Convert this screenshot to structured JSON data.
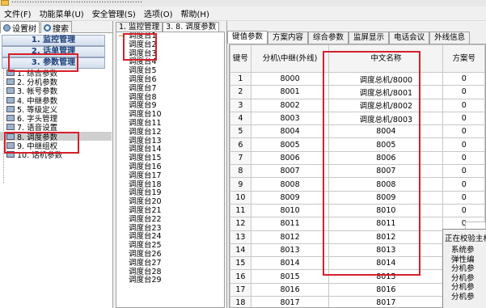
{
  "title_bar": {
    "text": "..................................................."
  },
  "menu": [
    "文件(F)",
    "功能菜单(U)",
    "安全管理(S)",
    "选项(O)",
    "帮助(H)"
  ],
  "left_panel": {
    "tabs": [
      "设置树",
      "搜索"
    ],
    "nav_buttons": [
      "1. 监控管理",
      "2. 话单管理",
      "3. 参数管理"
    ],
    "tree_items": [
      "1. 综合参数",
      "2. 分机参数",
      "3. 帐号参数",
      "4. 中继参数",
      "5. 等级定义",
      "6. 字头管理",
      "7. 语音设置",
      "8. 调度参数",
      "9. 中继组权",
      "10. 话机参数"
    ],
    "selected_index": 7
  },
  "middle_panel": {
    "tabs": [
      "1. 监控管理",
      "3. 8. 调度参数"
    ],
    "items": [
      "调度台1",
      "调度台2",
      "调度台3",
      "调度台4",
      "调度台5",
      "调度台6",
      "调度台7",
      "调度台8",
      "调度台9",
      "调度台10",
      "调度台11",
      "调度台12",
      "调度台13",
      "调度台14",
      "调度台15",
      "调度台16",
      "调度台17",
      "调度台18",
      "调度台19",
      "调度台20",
      "调度台21",
      "调度台22",
      "调度台23",
      "调度台24",
      "调度台25",
      "调度台26",
      "调度台27",
      "调度台28",
      "调度台29"
    ]
  },
  "right_panel": {
    "tabs": [
      "键值参数",
      "方案内容",
      "综合参数",
      "监屏显示",
      "电话会议",
      "外线信息"
    ],
    "columns": [
      "键号",
      "分机\\中继(外线)",
      "中文名称",
      "方案号"
    ],
    "rows": [
      [
        "1",
        "8000",
        "调度总机/8000",
        "0"
      ],
      [
        "2",
        "8001",
        "调度总机/8001",
        "0"
      ],
      [
        "3",
        "8002",
        "调度总机/8002",
        "0"
      ],
      [
        "4",
        "8003",
        "调度总机/8003",
        "0"
      ],
      [
        "5",
        "8004",
        "8004",
        "0"
      ],
      [
        "6",
        "8005",
        "8005",
        "0"
      ],
      [
        "7",
        "8006",
        "8006",
        "0"
      ],
      [
        "8",
        "8007",
        "8007",
        "0"
      ],
      [
        "9",
        "8008",
        "8008",
        "0"
      ],
      [
        "10",
        "8009",
        "8009",
        "0"
      ],
      [
        "11",
        "8010",
        "8010",
        "0"
      ],
      [
        "12",
        "8011",
        "8011",
        "0"
      ],
      [
        "13",
        "8012",
        "8012",
        ""
      ],
      [
        "14",
        "8013",
        "8013",
        ""
      ],
      [
        "15",
        "8014",
        "8014",
        ""
      ],
      [
        "16",
        "8015",
        "8015",
        ""
      ],
      [
        "17",
        "8016",
        "8016",
        ""
      ],
      [
        "18",
        "8017",
        "8017",
        ""
      ]
    ]
  },
  "popup": {
    "title": "正在校验主机",
    "lines": [
      "系统参",
      "弹性编",
      "分机参",
      "分机参",
      "分机参",
      "分机参"
    ]
  },
  "annotation_color": "#d6202a"
}
